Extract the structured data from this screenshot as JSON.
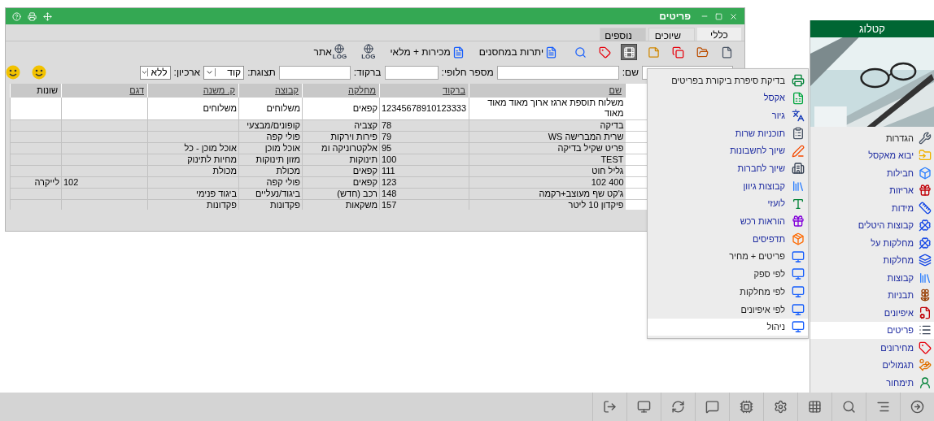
{
  "window": {
    "title": "פריטים",
    "tabs": [
      {
        "label": "כללי",
        "selected": true
      },
      {
        "label": "שיוכים",
        "selected": false
      },
      {
        "label": "נוספים",
        "selected": false
      }
    ],
    "toolbar": [
      {
        "kind": "icon"
      },
      {
        "kind": "icon"
      },
      {
        "kind": "icon"
      },
      {
        "kind": "icon"
      },
      {
        "kind": "icon"
      },
      {
        "kind": "icon"
      },
      {
        "kind": "icon"
      },
      {
        "kind": "text",
        "label": "יתרות במחסנים"
      },
      {
        "kind": "text",
        "label": "מכירות + מלאי"
      },
      {
        "kind": "log",
        "badge": "LOG"
      },
      {
        "kind": "log",
        "badge": "LOG",
        "label": "אתר"
      }
    ],
    "filters": [
      {
        "kind": "input"
      },
      {
        "kind": "input",
        "label": "שם:"
      },
      {
        "kind": "input",
        "label": "מספר חלופי:"
      },
      {
        "kind": "input",
        "label": "ברקוד:"
      },
      {
        "kind": "select",
        "label": "תצוגת:",
        "value": "קוד"
      },
      {
        "kind": "select",
        "label": "ארכיון:",
        "value": "ללא"
      }
    ],
    "table": {
      "columns": [
        "שם",
        "ברקוד",
        "מחלקה",
        "קבוצה",
        "ק. משנה",
        "דגם",
        "שונות"
      ],
      "rows": [
        {
          "selected": true,
          "cells": [
            "משלוח תוספת ארגז ארוך מאוד מאוד מאוד",
            "12345678910123333",
            "קפאים",
            "משלוחים",
            "משלוחים",
            "",
            ""
          ]
        },
        {
          "selected": false,
          "cells": [
            "בדיקה",
            "78",
            "קצביה",
            "קופונים/מבצעי",
            "",
            "",
            ""
          ]
        },
        {
          "selected": false,
          "cells": [
            "שרית המברישה WS",
            "79",
            "פירות וירקות",
            "פולי קפה",
            "",
            "",
            ""
          ]
        },
        {
          "selected": false,
          "cells": [
            "פריט שקיל בדיקה",
            "95",
            "אלקטרוניקה ומ",
            "אוכל מוכן",
            "אוכל מוכן - כל",
            "",
            ""
          ]
        },
        {
          "selected": false,
          "cells": [
            "TEST",
            "100",
            "תינוקות",
            "מזון תינוקות",
            "מחיות לתינוק",
            "",
            ""
          ]
        },
        {
          "selected": false,
          "cells": [
            "גליל חוט",
            "111",
            "קפאים",
            "מכולת",
            "מכולת",
            "",
            ""
          ]
        },
        {
          "selected": false,
          "cells": [
            "400 102",
            "123",
            "קפאים",
            "פולי קפה",
            "",
            "102",
            "לייקרה"
          ]
        },
        {
          "selected": false,
          "cells": [
            "ג'קט שף מעוצב+רקמה",
            "148",
            "רכב (חדש)",
            "ביגוד/נעליים",
            "ביגוד פנימי",
            "",
            ""
          ]
        },
        {
          "selected": false,
          "cells": [
            "פיקדון 10 ליטר",
            "157",
            "משקאות",
            "פקדונות",
            "פקדונות",
            "",
            ""
          ]
        }
      ]
    }
  },
  "menu": {
    "items": [
      {
        "label": "בדיקת סיפרת ביקורת בפריטים",
        "kind": "report",
        "selected": false
      },
      {
        "label": "אקסל",
        "kind": "action",
        "selected": false
      },
      {
        "label": "גיור",
        "kind": "action",
        "selected": false
      },
      {
        "label": "תוכניות שרות",
        "kind": "action",
        "selected": false
      },
      {
        "label": "שיוך לחשבונות",
        "kind": "action",
        "selected": false
      },
      {
        "label": "שיוך לחברות",
        "kind": "action",
        "selected": false
      },
      {
        "label": "קבוצות גיוון",
        "kind": "action",
        "selected": false
      },
      {
        "label": "לועזי",
        "kind": "action",
        "selected": false
      },
      {
        "label": "הוראות רכש",
        "kind": "action",
        "selected": false
      },
      {
        "label": "תדפיסים",
        "kind": "action",
        "selected": false
      },
      {
        "label": "פריטים + מחיר",
        "kind": "report",
        "selected": false
      },
      {
        "label": "לפי ספק",
        "kind": "report",
        "selected": false
      },
      {
        "label": "לפי מחלקות",
        "kind": "report",
        "selected": false
      },
      {
        "label": "לפי איפיונים",
        "kind": "report",
        "selected": false
      },
      {
        "label": "ניהול",
        "kind": "report",
        "selected": true
      }
    ]
  },
  "sidebar": {
    "title": "קטלוג",
    "items": [
      {
        "label": "הגדרות",
        "kind": "plain",
        "selected": false
      },
      {
        "label": "יבוא מאקסל",
        "kind": "link",
        "selected": false
      },
      {
        "label": "חבילות",
        "kind": "link",
        "selected": false
      },
      {
        "label": "אריזות",
        "kind": "link",
        "selected": false
      },
      {
        "label": "מידות",
        "kind": "link",
        "selected": false
      },
      {
        "label": "קבוצות היטלים",
        "kind": "link",
        "selected": false
      },
      {
        "label": "מחלקות על",
        "kind": "link",
        "selected": false
      },
      {
        "label": "מחלקות",
        "kind": "link",
        "selected": false
      },
      {
        "label": "קבוצות",
        "kind": "link",
        "selected": false
      },
      {
        "label": "תבניות",
        "kind": "link",
        "selected": false
      },
      {
        "label": "איפיונים",
        "kind": "link",
        "selected": false
      },
      {
        "label": "פריטים",
        "kind": "link",
        "selected": true
      },
      {
        "label": "מחירונים",
        "kind": "link",
        "selected": false
      },
      {
        "label": "תגמולים",
        "kind": "link",
        "selected": false
      },
      {
        "label": "תימחור",
        "kind": "link",
        "selected": false
      }
    ]
  }
}
